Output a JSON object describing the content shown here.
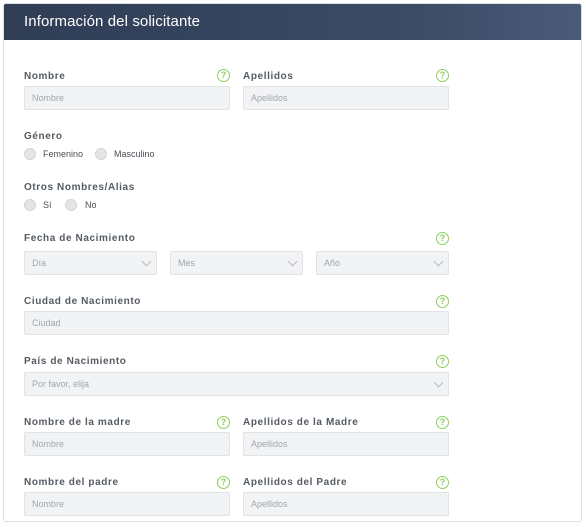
{
  "header": {
    "title": "Información del solicitante"
  },
  "fields": {
    "nombre": {
      "label": "Nombre",
      "placeholder": "Nombre"
    },
    "apellidos": {
      "label": "Apellidos",
      "placeholder": "Apellidos"
    },
    "genero": {
      "label": "Género",
      "options": [
        "Femenino",
        "Masculino"
      ]
    },
    "alias": {
      "label": "Otros Nombres/Alias",
      "options": [
        "Sí",
        "No"
      ]
    },
    "fecha": {
      "label": "Fecha de Nacimiento",
      "dia": "Día",
      "mes": "Mes",
      "anio": "Año"
    },
    "ciudad": {
      "label": "Ciudad de Nacimiento",
      "placeholder": "Ciudad"
    },
    "pais": {
      "label": "País de Nacimiento",
      "placeholder": "Por favor, elija"
    },
    "nombre_madre": {
      "label": "Nombre de la madre",
      "placeholder": "Nombre"
    },
    "apellidos_madre": {
      "label": "Apellidos de la Madre",
      "placeholder": "Apellidos"
    },
    "nombre_padre": {
      "label": "Nombre del padre",
      "placeholder": "Nombre"
    },
    "apellidos_padre": {
      "label": "Apellidos del Padre",
      "placeholder": "Apellidos"
    }
  },
  "help_glyph": "?",
  "colors": {
    "header": "#344360",
    "help": "#8ccf5a"
  }
}
